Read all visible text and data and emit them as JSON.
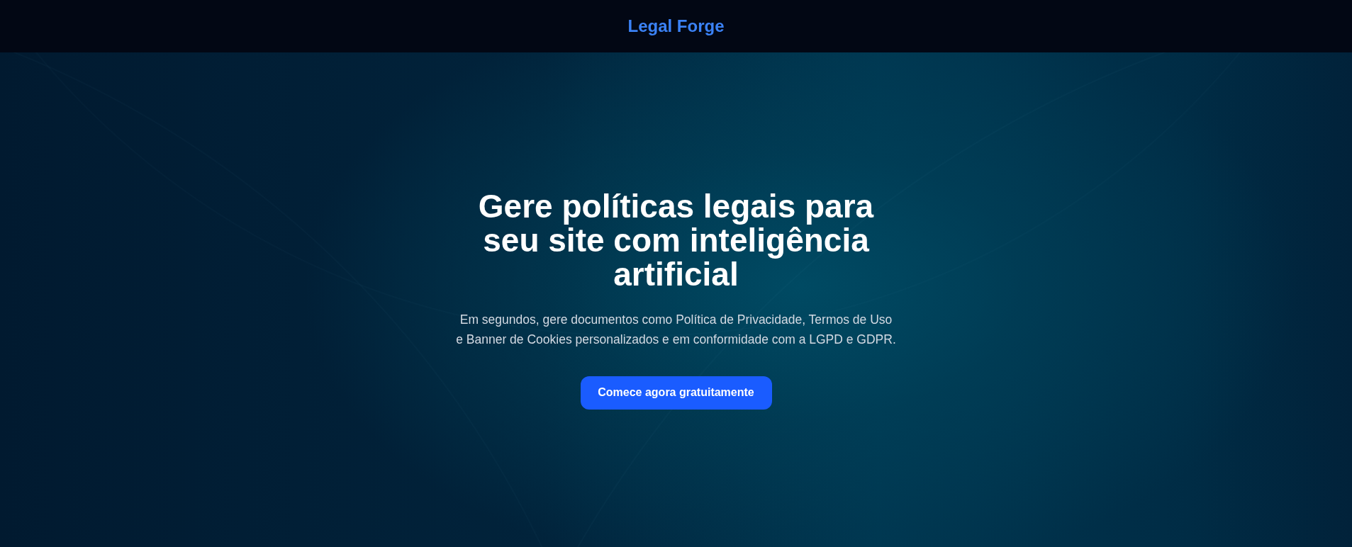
{
  "header": {
    "logo": "Legal Forge"
  },
  "hero": {
    "heading": "Gere políticas legais para seu site com inteligência artificial",
    "subtitle": "Em segundos, gere documentos como Política de Privacidade, Termos de Uso e Banner de Cookies personalizados e em conformidade com a LGPD e GDPR.",
    "cta": "Comece agora gratuitamente"
  }
}
